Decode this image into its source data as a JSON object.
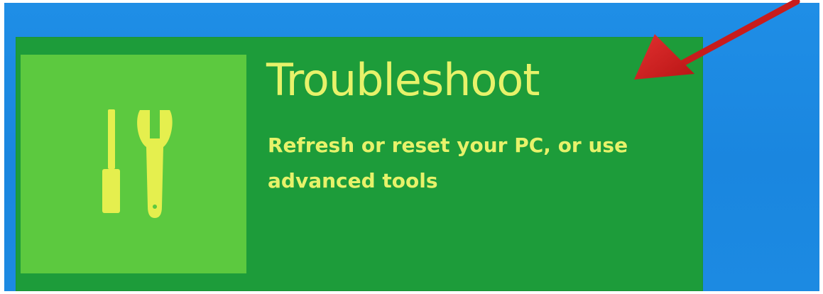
{
  "tile": {
    "title": "Troubleshoot",
    "description": "Refresh or reset your PC, or use advanced tools",
    "icon": "tools-icon"
  },
  "annotation": {
    "icon": "red-arrow-icon"
  },
  "colors": {
    "background": "#1f8ee6",
    "tile": "#1d9c3a",
    "icon_box": "#5cc93f",
    "text": "#e7f26a",
    "arrow": "#d42323"
  }
}
